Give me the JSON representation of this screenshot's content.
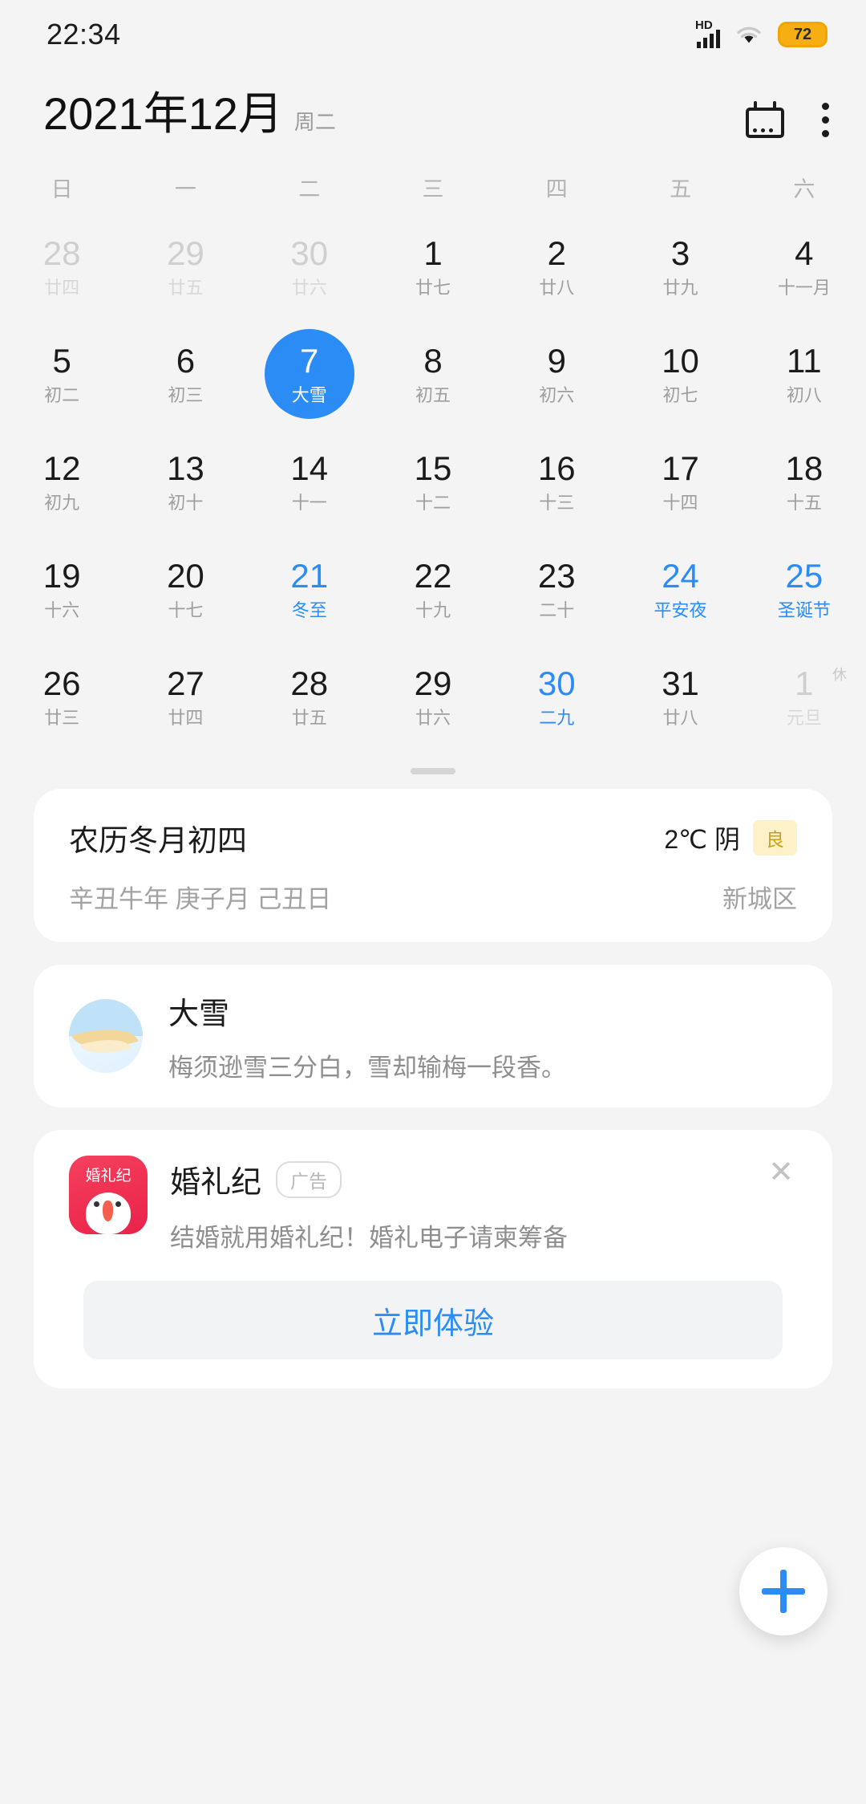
{
  "statusbar": {
    "time": "22:34",
    "hd_label": "HD",
    "battery_percent": "72"
  },
  "header": {
    "title": "2021年12月",
    "weekday": "周二",
    "calendar_icon": "calendar-icon",
    "more_icon": "more-vertical-icon"
  },
  "calendar": {
    "weekday_headers": [
      "日",
      "一",
      "二",
      "三",
      "四",
      "五",
      "六"
    ],
    "weeks": [
      [
        {
          "day": "28",
          "lunar": "廿四",
          "other": true
        },
        {
          "day": "29",
          "lunar": "廿五",
          "other": true
        },
        {
          "day": "30",
          "lunar": "廿六",
          "other": true
        },
        {
          "day": "1",
          "lunar": "廿七"
        },
        {
          "day": "2",
          "lunar": "廿八"
        },
        {
          "day": "3",
          "lunar": "廿九"
        },
        {
          "day": "4",
          "lunar": "十一月"
        }
      ],
      [
        {
          "day": "5",
          "lunar": "初二"
        },
        {
          "day": "6",
          "lunar": "初三"
        },
        {
          "day": "7",
          "lunar": "大雪",
          "selected": true
        },
        {
          "day": "8",
          "lunar": "初五"
        },
        {
          "day": "9",
          "lunar": "初六"
        },
        {
          "day": "10",
          "lunar": "初七"
        },
        {
          "day": "11",
          "lunar": "初八"
        }
      ],
      [
        {
          "day": "12",
          "lunar": "初九"
        },
        {
          "day": "13",
          "lunar": "初十"
        },
        {
          "day": "14",
          "lunar": "十一"
        },
        {
          "day": "15",
          "lunar": "十二"
        },
        {
          "day": "16",
          "lunar": "十三"
        },
        {
          "day": "17",
          "lunar": "十四"
        },
        {
          "day": "18",
          "lunar": "十五"
        }
      ],
      [
        {
          "day": "19",
          "lunar": "十六"
        },
        {
          "day": "20",
          "lunar": "十七"
        },
        {
          "day": "21",
          "lunar": "冬至",
          "accent": true
        },
        {
          "day": "22",
          "lunar": "十九"
        },
        {
          "day": "23",
          "lunar": "二十"
        },
        {
          "day": "24",
          "lunar": "平安夜",
          "accent": true
        },
        {
          "day": "25",
          "lunar": "圣诞节",
          "accent": true
        }
      ],
      [
        {
          "day": "26",
          "lunar": "廿三"
        },
        {
          "day": "27",
          "lunar": "廿四"
        },
        {
          "day": "28",
          "lunar": "廿五"
        },
        {
          "day": "29",
          "lunar": "廿六"
        },
        {
          "day": "30",
          "lunar": "二九",
          "accent": true
        },
        {
          "day": "31",
          "lunar": "廿八"
        },
        {
          "day": "1",
          "lunar": "元旦",
          "other": true,
          "mark": "休"
        }
      ]
    ]
  },
  "lunar_card": {
    "lunar_date": "农历冬月初四",
    "ganzhi": "辛丑牛年 庚子月 己丑日",
    "temperature": "2℃ 阴",
    "aqi": "良",
    "location": "新城区"
  },
  "term_card": {
    "icon": "snow-term-icon",
    "title": "大雪",
    "desc": "梅须逊雪三分白，雪却输梅一段香。"
  },
  "ad_card": {
    "icon": "hunliji-app-icon",
    "icon_brand_text": "婚礼纪",
    "title": "婚礼纪",
    "badge": "广告",
    "desc": "结婚就用婚礼纪！婚礼电子请柬筹备",
    "cta": "立即体验",
    "close_icon": "close-icon"
  },
  "fab": {
    "icon": "plus-icon"
  },
  "colors": {
    "accent": "#2b8cf5",
    "background": "#f4f4f4",
    "card": "#ffffff",
    "aqi_bg": "#fdf1c8",
    "aqi_text": "#c8a11a",
    "battery": "#f6ae12"
  }
}
